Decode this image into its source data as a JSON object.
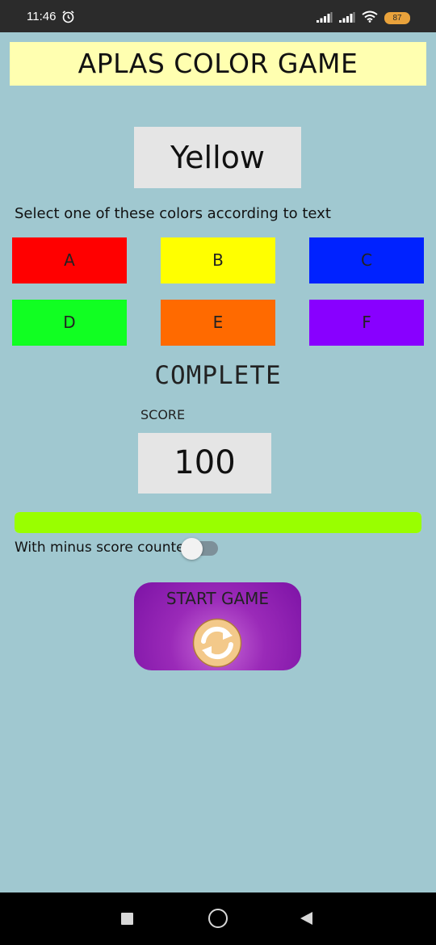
{
  "status_bar": {
    "time": "11:46",
    "battery": "87",
    "icons": [
      "alarm-icon",
      "signal-icon",
      "signal-icon",
      "wifi-icon",
      "battery-icon"
    ]
  },
  "app": {
    "title": "APLAS COLOR GAME",
    "color_word": "Yellow",
    "instruction": "Select one of these colors according to text",
    "choices": [
      {
        "label": "A",
        "color": "#ff0000"
      },
      {
        "label": "B",
        "color": "#ffff00"
      },
      {
        "label": "C",
        "color": "#0022ff"
      },
      {
        "label": "D",
        "color": "#11ff22"
      },
      {
        "label": "E",
        "color": "#ff6a00"
      },
      {
        "label": "F",
        "color": "#8800ff"
      }
    ],
    "status_text": "COMPLETE",
    "score_label": "SCORE",
    "score_value": "100",
    "progress_fraction": 1.0,
    "progress_color": "#99ff00",
    "toggle_label": "With minus score counter",
    "toggle_on": false,
    "start_label": "START GAME",
    "start_icon": "refresh-icon"
  },
  "colors": {
    "background": "#a0c8d0",
    "title_background": "#ffffb0",
    "box_background": "#e5e5e5",
    "button_purple": "#8a1aad"
  },
  "nav_bar": {
    "buttons": [
      "recents-icon",
      "home-icon",
      "back-icon"
    ]
  }
}
